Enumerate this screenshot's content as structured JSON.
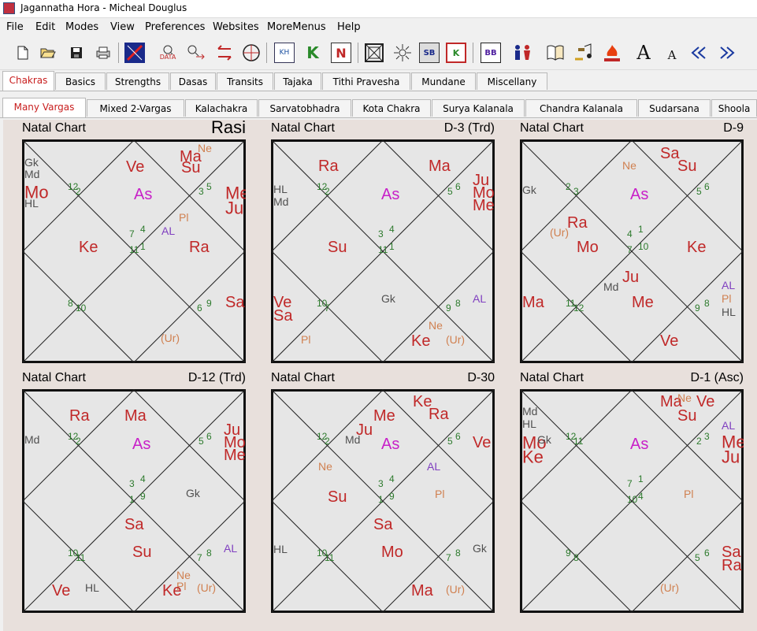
{
  "window": {
    "title": "Jagannatha Hora - Micheal Douglus"
  },
  "menus": [
    "File",
    "Edit",
    "Modes",
    "View",
    "Preferences",
    "Websites",
    "MoreMenus",
    "Help"
  ],
  "toolbar": {
    "icons": [
      "new-file-icon",
      "open-folder-icon",
      "save-icon",
      "print-icon",
      "chart-pen-icon",
      "data-icon",
      "compare-icon",
      "transfer-icon",
      "globe-icon",
      "kh-icon",
      "k-icon",
      "n-icon",
      "grid-icon",
      "sun-icon",
      "sb-icon",
      "kbox-icon",
      "bb-icon",
      "people-icon",
      "book-icon",
      "music-icon",
      "fire-icon",
      "font-larger-icon",
      "font-smaller-icon",
      "prev-icon",
      "next-icon"
    ],
    "labels": {
      "data": "DATA",
      "kh": "KH",
      "k": "K",
      "n": "N",
      "sb": "SB",
      "kbox": "K",
      "bb": "BB",
      "font_large": "A",
      "font_small": "A"
    }
  },
  "main_tabs": {
    "active": 0,
    "items": [
      "Chakras",
      "Basics",
      "Strengths",
      "Dasas",
      "Transits",
      "Tajaka",
      "Tithi Pravesha",
      "Mundane",
      "Miscellany"
    ]
  },
  "sub_tabs": {
    "active": 0,
    "items": [
      "Many Vargas",
      "Mixed 2-Vargas",
      "Kalachakra",
      "Sarvatobhadra",
      "Kota Chakra",
      "Surya Kalanala",
      "Chandra Kalanala",
      "Sudarsana",
      "Shoola"
    ]
  },
  "colors": {
    "red": "#c02828",
    "magenta": "#c820c8",
    "green": "#3a8a3a",
    "grey": "#505050",
    "orange": "#d08050",
    "purple": "#8040c0",
    "house": "#2c7a2c"
  },
  "charts": [
    {
      "name": "Natal Chart",
      "division": "Rasi",
      "houses": [
        "7",
        "4",
        "1",
        "11",
        "12",
        "2",
        "3",
        "5",
        "6",
        "9",
        "8",
        "10"
      ],
      "planets": [
        [
          "Ma",
          200,
          12,
          "red",
          20
        ],
        [
          "Ne",
          223,
          5,
          "orange",
          14
        ],
        [
          "Ve",
          132,
          25,
          "red",
          20
        ],
        [
          "Su",
          202,
          26,
          "red",
          20
        ],
        [
          "Gk",
          3,
          23,
          "grey",
          14
        ],
        [
          "Md",
          3,
          38,
          "grey",
          14
        ],
        [
          "Mo",
          3,
          57,
          "red",
          22
        ],
        [
          "HL",
          3,
          75,
          "grey",
          14
        ],
        [
          "As",
          142,
          60,
          "magenta",
          20
        ],
        [
          "Me",
          258,
          58,
          "red",
          22
        ],
        [
          "Ju",
          258,
          77,
          "red",
          22
        ],
        [
          "Pl",
          199,
          93,
          "orange",
          14
        ],
        [
          "AL",
          177,
          110,
          "purple",
          14
        ],
        [
          "Ke",
          72,
          127,
          "red",
          20
        ],
        [
          "Ra",
          212,
          127,
          "red",
          20
        ],
        [
          "Sa",
          258,
          197,
          "red",
          20
        ],
        [
          "(Ur)",
          176,
          246,
          "orange",
          14
        ]
      ]
    },
    {
      "name": "Natal Chart",
      "division": "D-3 (Trd)",
      "houses": [
        "3",
        "4",
        "1",
        "11",
        "12",
        "2",
        "5",
        "6",
        "9",
        "8",
        "10",
        "7"
      ],
      "planets": [
        [
          "Ra",
          60,
          24,
          "red",
          20
        ],
        [
          "Ma",
          200,
          24,
          "red",
          20
        ],
        [
          "Ju",
          256,
          42,
          "red",
          20
        ],
        [
          "Mo",
          256,
          58,
          "red",
          20
        ],
        [
          "Me",
          256,
          74,
          "red",
          20
        ],
        [
          "HL",
          3,
          57,
          "grey",
          14
        ],
        [
          "Md",
          3,
          73,
          "grey",
          14
        ],
        [
          "As",
          140,
          60,
          "magenta",
          20
        ],
        [
          "Su",
          72,
          127,
          "red",
          20
        ],
        [
          "Gk",
          140,
          196,
          "grey",
          14
        ],
        [
          "AL",
          256,
          196,
          "purple",
          14
        ],
        [
          "Ve",
          3,
          197,
          "red",
          20
        ],
        [
          "Sa",
          3,
          214,
          "red",
          20
        ],
        [
          "Ne",
          200,
          230,
          "orange",
          14
        ],
        [
          "Ke",
          178,
          246,
          "red",
          20
        ],
        [
          "(Ur)",
          222,
          248,
          "orange",
          14
        ],
        [
          "Pl",
          38,
          248,
          "orange",
          14
        ]
      ]
    },
    {
      "name": "Natal Chart",
      "division": "D-9",
      "houses": [
        "4",
        "1",
        "10",
        "7",
        "2",
        "3",
        "5",
        "6",
        "9",
        "8",
        "11",
        "12"
      ],
      "planets": [
        [
          "Sa",
          178,
          8,
          "red",
          20
        ],
        [
          "Su",
          200,
          24,
          "red",
          20
        ],
        [
          "Ne",
          130,
          27,
          "orange",
          14
        ],
        [
          "Gk",
          3,
          58,
          "grey",
          14
        ],
        [
          "As",
          140,
          60,
          "magenta",
          20
        ],
        [
          "Ra",
          60,
          96,
          "red",
          20
        ],
        [
          "(Ur)",
          38,
          112,
          "orange",
          14
        ],
        [
          "Mo",
          72,
          127,
          "red",
          20
        ],
        [
          "Ke",
          212,
          127,
          "red",
          20
        ],
        [
          "Ju",
          130,
          165,
          "red",
          20
        ],
        [
          "Md",
          106,
          181,
          "grey",
          14
        ],
        [
          "Me",
          142,
          197,
          "red",
          20
        ],
        [
          "AL",
          256,
          179,
          "purple",
          14
        ],
        [
          "Pl",
          256,
          196,
          "orange",
          14
        ],
        [
          "HL",
          256,
          213,
          "grey",
          14
        ],
        [
          "Ma",
          3,
          197,
          "red",
          20
        ],
        [
          "Ve",
          178,
          246,
          "red",
          20
        ]
      ]
    },
    {
      "name": "Natal Chart",
      "division": "D-12 (Trd)",
      "houses": [
        "3",
        "4",
        "9",
        "1",
        "12",
        "2",
        "5",
        "6",
        "7",
        "8",
        "10",
        "11"
      ],
      "planets": [
        [
          "Ra",
          60,
          24,
          "red",
          20
        ],
        [
          "Ma",
          130,
          24,
          "red",
          20
        ],
        [
          "Md",
          3,
          58,
          "grey",
          14
        ],
        [
          "As",
          140,
          60,
          "magenta",
          20
        ],
        [
          "Ju",
          256,
          42,
          "red",
          20
        ],
        [
          "Mo",
          256,
          58,
          "red",
          20
        ],
        [
          "Me",
          256,
          74,
          "red",
          20
        ],
        [
          "Gk",
          208,
          126,
          "grey",
          14
        ],
        [
          "Sa",
          130,
          162,
          "red",
          20
        ],
        [
          "Su",
          140,
          197,
          "red",
          20
        ],
        [
          "AL",
          256,
          196,
          "purple",
          14
        ],
        [
          "Ne",
          196,
          230,
          "orange",
          14
        ],
        [
          "Pl",
          196,
          244,
          "orange",
          14
        ],
        [
          "(Ur)",
          222,
          246,
          "orange",
          14
        ],
        [
          "Ve",
          38,
          246,
          "red",
          20
        ],
        [
          "HL",
          80,
          246,
          "grey",
          14
        ],
        [
          "Ke",
          178,
          246,
          "red",
          20
        ]
      ]
    },
    {
      "name": "Natal Chart",
      "division": "D-30",
      "houses": [
        "3",
        "4",
        "9",
        "1",
        "12",
        "2",
        "5",
        "6",
        "7",
        "8",
        "10",
        "11"
      ],
      "planets": [
        [
          "Ke",
          180,
          6,
          "red",
          20
        ],
        [
          "Ra",
          200,
          22,
          "red",
          20
        ],
        [
          "Me",
          130,
          24,
          "red",
          20
        ],
        [
          "Ju",
          108,
          42,
          "red",
          20
        ],
        [
          "Md",
          94,
          58,
          "grey",
          14
        ],
        [
          "As",
          140,
          60,
          "magenta",
          20
        ],
        [
          "Ve",
          256,
          58,
          "red",
          20
        ],
        [
          "Ne",
          60,
          92,
          "orange",
          14
        ],
        [
          "AL",
          198,
          92,
          "purple",
          14
        ],
        [
          "Su",
          72,
          127,
          "red",
          20
        ],
        [
          "Pl",
          208,
          127,
          "orange",
          14
        ],
        [
          "Sa",
          130,
          162,
          "red",
          20
        ],
        [
          "Mo",
          140,
          197,
          "red",
          20
        ],
        [
          "HL",
          3,
          197,
          "grey",
          14
        ],
        [
          "Gk",
          256,
          196,
          "grey",
          14
        ],
        [
          "Ma",
          178,
          246,
          "red",
          20
        ],
        [
          "(Ur)",
          222,
          248,
          "orange",
          14
        ]
      ]
    },
    {
      "name": "Natal Chart",
      "division": "D-1 (Asc)",
      "houses": [
        "7",
        "1",
        "4",
        "10",
        "12",
        "11",
        "2",
        "3",
        "5",
        "6",
        "9",
        "8"
      ],
      "planets": [
        [
          "Ma",
          178,
          6,
          "red",
          20
        ],
        [
          "Ne",
          200,
          5,
          "orange",
          14
        ],
        [
          "Ve",
          224,
          6,
          "red",
          20
        ],
        [
          "Su",
          200,
          24,
          "red",
          20
        ],
        [
          "Md",
          3,
          22,
          "grey",
          14
        ],
        [
          "HL",
          3,
          38,
          "grey",
          14
        ],
        [
          "Mo",
          3,
          58,
          "red",
          22
        ],
        [
          "Gk",
          22,
          58,
          "grey",
          14
        ],
        [
          "Ke",
          3,
          76,
          "red",
          22
        ],
        [
          "As",
          140,
          60,
          "magenta",
          20
        ],
        [
          "AL",
          256,
          40,
          "purple",
          14
        ],
        [
          "Me",
          256,
          57,
          "red",
          22
        ],
        [
          "Ju",
          256,
          76,
          "red",
          22
        ],
        [
          "Pl",
          208,
          127,
          "orange",
          14
        ],
        [
          "Sa",
          256,
          197,
          "red",
          20
        ],
        [
          "Ra",
          256,
          214,
          "red",
          20
        ],
        [
          "(Ur)",
          178,
          246,
          "orange",
          14
        ]
      ]
    }
  ]
}
